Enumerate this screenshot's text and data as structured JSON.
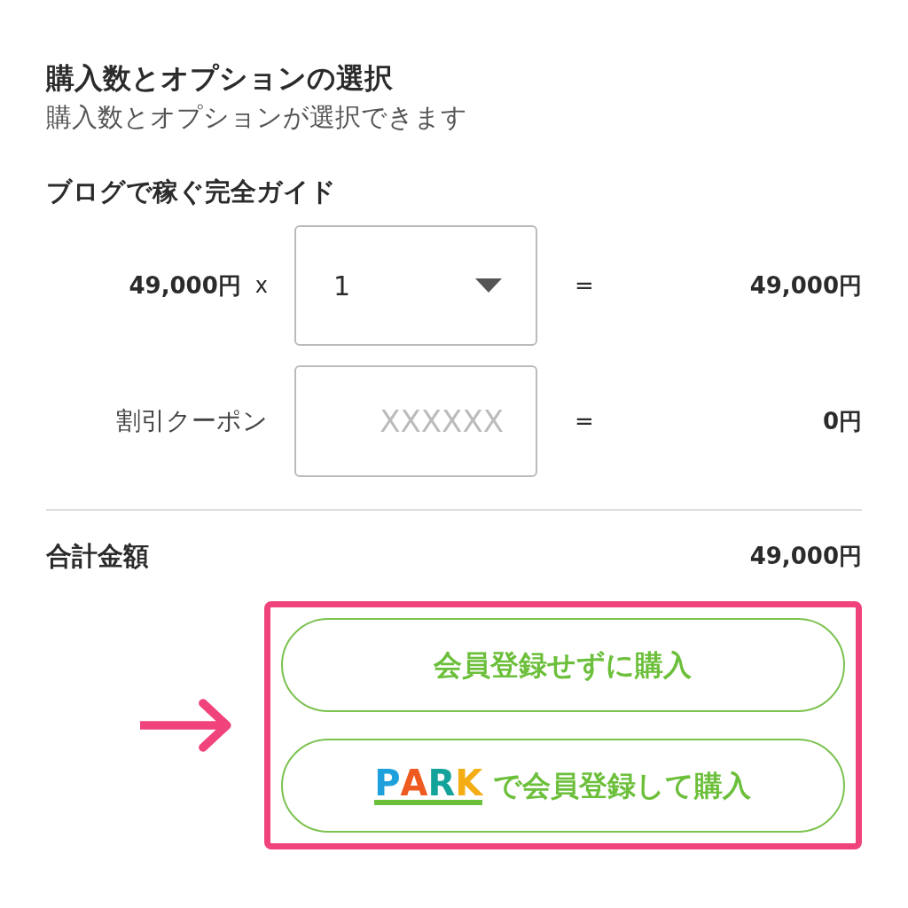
{
  "section": {
    "title": "購入数とオプションの選択",
    "subtitle": "購入数とオプションが選択できます"
  },
  "product": {
    "name": "ブログで稼ぐ完全ガイド",
    "unit_price": "49,000円",
    "times": "x",
    "quantity": "1",
    "equals": "=",
    "subtotal": "49,000円"
  },
  "coupon": {
    "label": "割引クーポン",
    "placeholder": "XXXXXX",
    "equals": "=",
    "discount": "0円"
  },
  "total": {
    "label": "合計金額",
    "amount": "49,000円"
  },
  "buttons": [
    {
      "kind": "plain",
      "label": "会員登録せずに購入"
    },
    {
      "kind": "park",
      "label": "で会員登録して購入",
      "logo_letters": [
        {
          "char": "P",
          "color": "#1ea0dc"
        },
        {
          "char": "A",
          "color": "#ee5a1f"
        },
        {
          "char": "R",
          "color": "#14a39a"
        },
        {
          "char": "K",
          "color": "#f4ad14"
        }
      ]
    }
  ]
}
